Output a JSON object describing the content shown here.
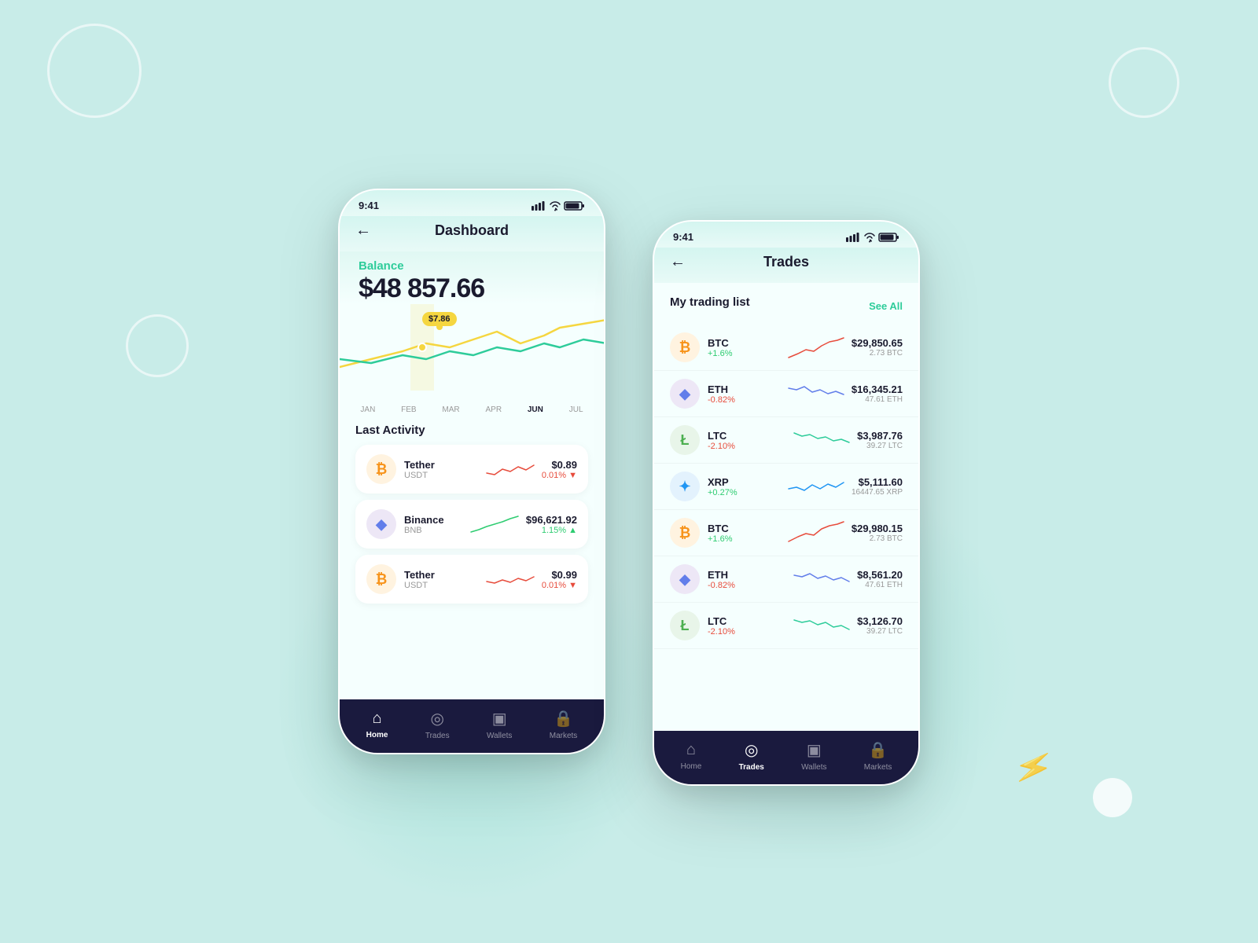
{
  "background": "#c8ece8",
  "phone_left": {
    "status_time": "9:41",
    "header_title": "Dashboard",
    "back_label": "←",
    "balance_label": "Balance",
    "balance_amount": "$48 857.66",
    "chart_tooltip": "$7.86",
    "chart_months": [
      "JAN",
      "FEB",
      "MAR",
      "APR",
      "JUN",
      "JUL"
    ],
    "chart_active_month": "JUN",
    "section_title": "Last Activity",
    "activities": [
      {
        "name": "Tether",
        "ticker": "USDT",
        "price": "$0.89",
        "change": "0.01%",
        "change_dir": "down",
        "icon": "₿",
        "icon_class": "coin-btc",
        "chart_color": "#e74c3c",
        "chart_up": false
      },
      {
        "name": "Binance",
        "ticker": "BNB",
        "price": "$96,621.92",
        "change": "1.15%",
        "change_dir": "up",
        "icon": "◆",
        "icon_class": "coin-eth",
        "chart_color": "#2ecc71",
        "chart_up": true
      },
      {
        "name": "Tether",
        "ticker": "USDT",
        "price": "$0.99",
        "change": "0.01%",
        "change_dir": "down",
        "icon": "₿",
        "icon_class": "coin-btc",
        "chart_color": "#e74c3c",
        "chart_up": false
      }
    ],
    "nav": [
      {
        "label": "Home",
        "icon": "⌂",
        "active": true
      },
      {
        "label": "Trades",
        "icon": "◎",
        "active": false
      },
      {
        "label": "Wallets",
        "icon": "▣",
        "active": false
      },
      {
        "label": "Markets",
        "icon": "🔒",
        "active": false
      }
    ]
  },
  "phone_right": {
    "status_time": "9:41",
    "header_title": "Trades",
    "back_label": "←",
    "section_title": "My trading list",
    "see_all": "See All",
    "trades": [
      {
        "name": "BTC",
        "change": "+1.6%",
        "change_dir": "up",
        "price": "$29,850.65",
        "amount": "2.73 BTC",
        "icon": "₿",
        "icon_class": "coin-btc",
        "chart_color": "#e74c3c"
      },
      {
        "name": "ETH",
        "change": "-0.82%",
        "change_dir": "down",
        "price": "$16,345.21",
        "amount": "47.61 ETH",
        "icon": "◆",
        "icon_class": "coin-eth",
        "chart_color": "#627eea"
      },
      {
        "name": "LTC",
        "change": "-2.10%",
        "change_dir": "down",
        "price": "$3,987.76",
        "amount": "39.27 LTC",
        "icon": "Ł",
        "icon_class": "coin-ltc",
        "chart_color": "#2ecc9a"
      },
      {
        "name": "XRP",
        "change": "+0.27%",
        "change_dir": "up",
        "price": "$5,111.60",
        "amount": "16447.65 XRP",
        "icon": "✦",
        "icon_class": "coin-xrp",
        "chart_color": "#2196f3"
      },
      {
        "name": "BTC",
        "change": "+1.6%",
        "change_dir": "up",
        "price": "$29,980.15",
        "amount": "2.73 BTC",
        "icon": "₿",
        "icon_class": "coin-btc",
        "chart_color": "#e74c3c"
      },
      {
        "name": "ETH",
        "change": "-0.82%",
        "change_dir": "down",
        "price": "$8,561.20",
        "amount": "47.61 ETH",
        "icon": "◆",
        "icon_class": "coin-eth",
        "chart_color": "#627eea"
      },
      {
        "name": "LTC",
        "change": "-2.10%",
        "change_dir": "down",
        "price": "$3,126.70",
        "amount": "39.27 LTC",
        "icon": "Ł",
        "icon_class": "coin-ltc",
        "chart_color": "#2ecc9a"
      }
    ],
    "nav": [
      {
        "label": "Home",
        "icon": "⌂",
        "active": false
      },
      {
        "label": "Trades",
        "icon": "◎",
        "active": true
      },
      {
        "label": "Wallets",
        "icon": "▣",
        "active": false
      },
      {
        "label": "Markets",
        "icon": "🔒",
        "active": false
      }
    ]
  }
}
